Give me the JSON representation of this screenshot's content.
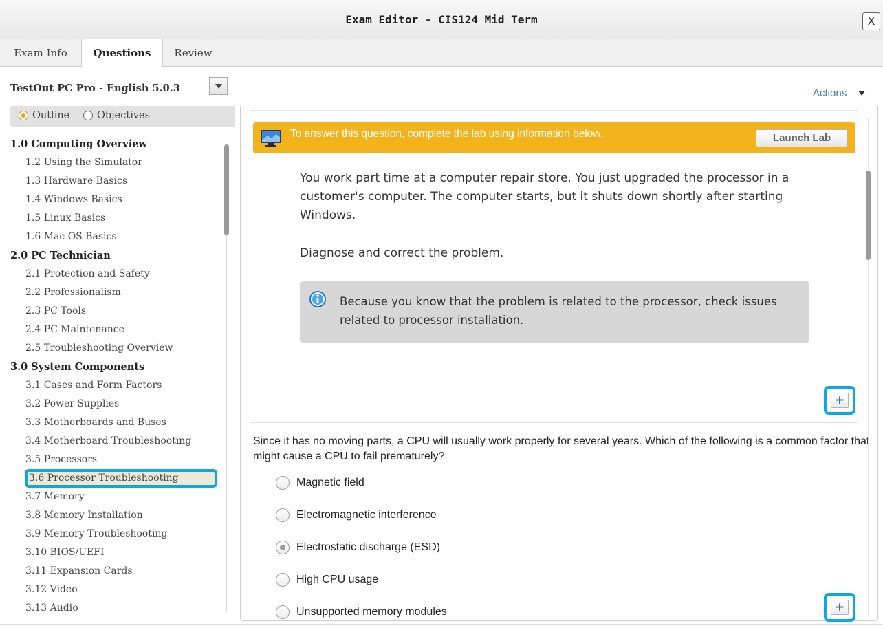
{
  "window": {
    "title": "Exam Editor - CIS124 Mid Term",
    "close_label": "X"
  },
  "tabs": [
    {
      "label": "Exam Info",
      "active": false
    },
    {
      "label": "Questions",
      "active": true
    },
    {
      "label": "Review",
      "active": false
    }
  ],
  "left_panel": {
    "course": "TestOut PC Pro - English 5.0.3",
    "view_options": [
      {
        "label": "Outline",
        "selected": true
      },
      {
        "label": "Objectives",
        "selected": false
      }
    ],
    "outline": [
      {
        "label": "1.0 Computing Overview",
        "type": "section"
      },
      {
        "label": "1.2 Using the Simulator",
        "type": "sub"
      },
      {
        "label": "1.3 Hardware Basics",
        "type": "sub"
      },
      {
        "label": "1.4 Windows Basics",
        "type": "sub"
      },
      {
        "label": "1.5 Linux Basics",
        "type": "sub"
      },
      {
        "label": "1.6 Mac OS Basics",
        "type": "sub"
      },
      {
        "label": "2.0 PC Technician",
        "type": "section"
      },
      {
        "label": "2.1 Protection and Safety",
        "type": "sub"
      },
      {
        "label": "2.2 Professionalism",
        "type": "sub"
      },
      {
        "label": "2.3 PC Tools",
        "type": "sub"
      },
      {
        "label": "2.4 PC Maintenance",
        "type": "sub"
      },
      {
        "label": "2.5 Troubleshooting Overview",
        "type": "sub"
      },
      {
        "label": "3.0 System Components",
        "type": "section"
      },
      {
        "label": "3.1 Cases and Form Factors",
        "type": "sub"
      },
      {
        "label": "3.2 Power Supplies",
        "type": "sub"
      },
      {
        "label": "3.3 Motherboards and Buses",
        "type": "sub"
      },
      {
        "label": "3.4 Motherboard Troubleshooting",
        "type": "sub"
      },
      {
        "label": "3.5 Processors",
        "type": "sub"
      },
      {
        "label": "3.6 Processor Troubleshooting",
        "type": "sub",
        "selected": true
      },
      {
        "label": "3.7 Memory",
        "type": "sub"
      },
      {
        "label": "3.8 Memory Installation",
        "type": "sub"
      },
      {
        "label": "3.9 Memory Troubleshooting",
        "type": "sub"
      },
      {
        "label": "3.10 BIOS/UEFI",
        "type": "sub"
      },
      {
        "label": "3.11 Expansion Cards",
        "type": "sub"
      },
      {
        "label": "3.12 Video",
        "type": "sub"
      },
      {
        "label": "3.13 Audio",
        "type": "sub"
      }
    ]
  },
  "actions": {
    "label": "Actions"
  },
  "question1": {
    "banner_text": "To answer this question, complete the lab using information below.",
    "launch_label": "Launch Lab",
    "scenario": "You work part time at a computer repair store. You just upgraded the processor in a customer's computer. The computer starts, but it shuts down shortly after starting Windows.",
    "instruction": "Diagnose and correct the problem.",
    "hint": "Because you know that the problem is related to the processor, check issues related to processor installation.",
    "add_label": "+"
  },
  "question2": {
    "text": "Since it has no moving parts, a CPU will usually work properly for several years. Which of the following is a common factor that might cause a CPU to fail prematurely?",
    "answers": [
      {
        "label": "Magnetic field",
        "selected": false
      },
      {
        "label": "Electromagnetic interference",
        "selected": false
      },
      {
        "label": "Electrostatic discharge (ESD)",
        "selected": true
      },
      {
        "label": "High CPU usage",
        "selected": false
      },
      {
        "label": "Unsupported memory modules",
        "selected": false
      }
    ],
    "add_label": "+"
  },
  "colors": {
    "banner": "#f2b31d",
    "highlight_border": "#10a7e0",
    "link": "#3a7bc1"
  }
}
